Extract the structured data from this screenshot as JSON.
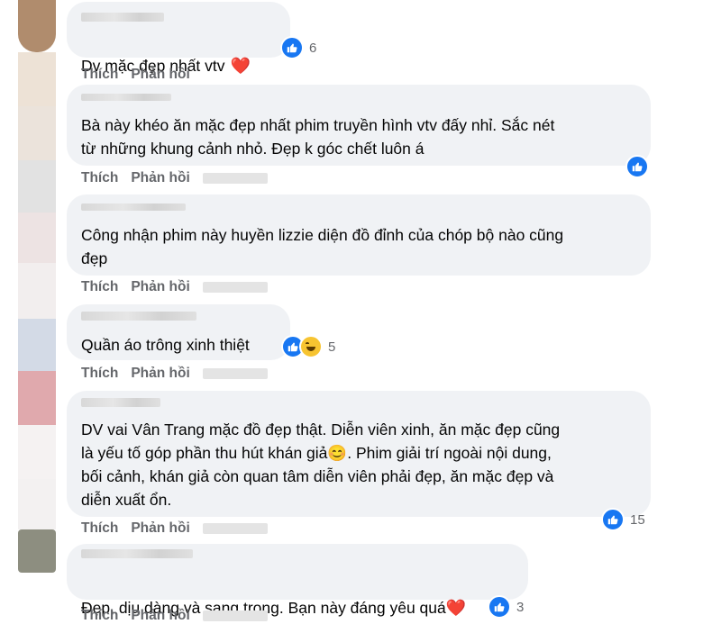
{
  "actions": {
    "like": "Thích",
    "reply": "Phản hồi"
  },
  "comments": [
    {
      "text": "Dv mặc đẹp nhất vtv",
      "heart": "❤️",
      "reaction_count": "6"
    },
    {
      "text": "Bà này khéo ăn mặc đẹp nhất phim truyền hình vtv đấy nhỉ. Sắc nét\ntừ những khung cảnh nhỏ. Đẹp k góc chết luôn á",
      "reaction_count": ""
    },
    {
      "text": "Công nhận phim này huyền lizzie diện đồ đỉnh của chóp bộ nào cũng\nđẹp"
    },
    {
      "text": "Quần áo trông xinh thiệt",
      "reaction_count": "5"
    },
    {
      "text_a": "DV vai Vân Trang mặc đồ đẹp thật. Diễn viên xinh, ăn mặc đẹp cũng\nlà yếu tố góp phần thu hút khán giả",
      "emoji": "😊",
      "text_b": ". Phim giải trí ngoài nội dung,\nbối cảnh, khán giả còn quan tâm diễn viên phải đẹp, ăn mặc đẹp và\ndiễn xuất ổn.",
      "reaction_count": "15"
    },
    {
      "text": "Đẹp, dịu dàng và sang trọng. Bạn này đáng yêu quá",
      "heart": "❤️",
      "reaction_count": "3"
    }
  ],
  "colors": {
    "bubble": "#f0f2f5",
    "like_blue": "#1877f2",
    "action_gray": "#65676b",
    "heart_red": "#e41e3f"
  },
  "icons": [
    "like-icon",
    "haha-icon",
    "heart-icon",
    "smile-emoji"
  ]
}
